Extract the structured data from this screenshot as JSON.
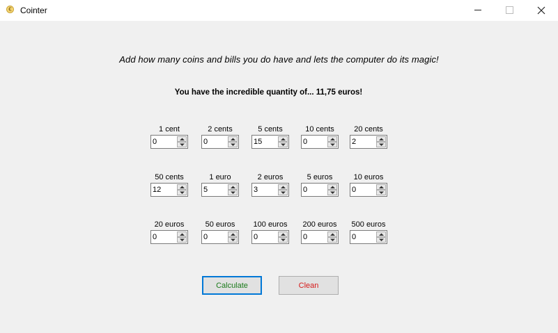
{
  "window": {
    "title": "Cointer"
  },
  "headline": "Add how many coins and bills you do have and lets the computer do its magic!",
  "result": "You have the incredible quantity of... 11,75 euros!",
  "rows": [
    [
      {
        "label": "1 cent",
        "value": "0"
      },
      {
        "label": "2 cents",
        "value": "0"
      },
      {
        "label": "5 cents",
        "value": "15"
      },
      {
        "label": "10 cents",
        "value": "0"
      },
      {
        "label": "20 cents",
        "value": "2"
      }
    ],
    [
      {
        "label": "50 cents",
        "value": "12"
      },
      {
        "label": "1 euro",
        "value": "5"
      },
      {
        "label": "2 euros",
        "value": "3"
      },
      {
        "label": "5 euros",
        "value": "0"
      },
      {
        "label": "10 euros",
        "value": "0"
      }
    ],
    [
      {
        "label": "20 euros",
        "value": "0"
      },
      {
        "label": "50 euros",
        "value": "0"
      },
      {
        "label": "100 euros",
        "value": "0"
      },
      {
        "label": "200 euros",
        "value": "0"
      },
      {
        "label": "500 euros",
        "value": "0"
      }
    ]
  ],
  "buttons": {
    "calculate": "Calculate",
    "clean": "Clean"
  }
}
